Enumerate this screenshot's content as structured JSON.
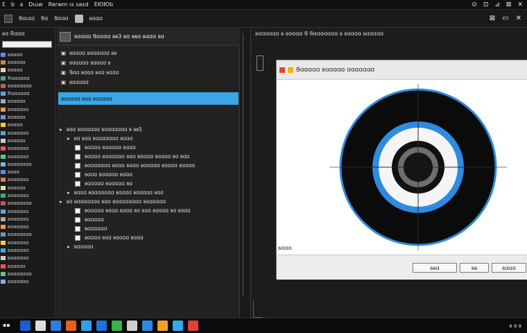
{
  "menubar": {
    "items": [
      "Ɛ",
      "b",
      "ꞩ",
      "Dɩuw",
      "Rerwm ɩs sasd",
      "ЕЮЮb"
    ],
    "right_icons": [
      "⊙",
      "⊡",
      "⊿",
      "⊠",
      "✕"
    ]
  },
  "toolbar": {
    "items": [
      "Ꞩɑɩɑɑ",
      "Ꞩɑ",
      "Ꞩɑɑɑ",
      "ꞩɑɑɑ"
    ],
    "right": [
      "⊠",
      "▭",
      "✕"
    ]
  },
  "sidebar": {
    "title": "ꞩɑ Rɑɑɑ",
    "items": [
      "ꞩɑɑɑɑ",
      "ꞩɑɑɑɑɑ",
      "ꞩɑɑɑɑ",
      "Rɑɑɑɑɑɑ",
      "ꞩɑɑɑɑɑɑɑ",
      "Rɑɑɑɑɑɑ",
      "ꞩɑɑɑɑɑ",
      "ꞩɑɑɑɑɑɑ",
      "ꞩɑɑɑɑɑ",
      "ꞩɑɑɑɑ",
      "ꞩɑɑɑɑɑɑ",
      "ꞩɑɑɑɑɑ",
      "ꞩɑɑɑɑɑɑ",
      "ꞩɑɑɑɑɑɑ",
      "ꞩɑɑɑɑɑɑɑ",
      "ꞩɑɑɑ",
      "ꞩɑɑɑɑɑɑ",
      "ꞩɑɑɑɑɑ",
      "ꞩɑɑɑɑɑɑ",
      "ꞩɑɑɑɑɑɑɑ",
      "ꞩɑɑɑɑɑɑ",
      "ꞩɑɑɑɑɑɑ",
      "ꞩɑɑɑɑɑɑ",
      "ꞩɑɑɑɑɑɑɑ",
      "ꞩɑɑɑɑɑɑ",
      "ꞩɑɑɑɑɑɑ",
      "ꞩɑɑɑɑɑɑ",
      "ꞩɑɑɑɑɑ",
      "ꞩɑɑɑɑɑɑɑ",
      "ꞩɑɑɑɑɑɑ"
    ]
  },
  "middle": {
    "header": "ꞩɑɑɑɑ Ꞩɑɑɑɑ ꞩꞩ3 ꞩɑ ꞩꞩɑ ꞩɑɑɑ ꞩɑ",
    "rows": [
      {
        "text": "ꞩɑɑɑɑ ꞩɑɑɑɑɑɑ ꞩꞩ",
        "indent": 0
      },
      {
        "text": "ꞩɑɑɑɑɑ ꞩɑɑɑɑ ꞩ",
        "indent": 0
      },
      {
        "text": "Ꞩɑɑ ꞩɑɑɑ ꞩɑɑ ꞩɑɑɑ",
        "indent": 0
      },
      {
        "text": "ꞩɑɑɑɑɑ",
        "indent": 0
      }
    ],
    "selected": "ꞩɑɑɑɑɑ ꞩɑɑ ꞩɑɑɑɑɑ",
    "tree": [
      {
        "text": "ꞩɑɑ ꞩɑɑɑɑɑɑ ꞩɑɑɑɑɑɑɑ ꞩ ꞩꞩ5",
        "indent": 0
      },
      {
        "text": "ꞩɑ ꞩɑɑ ꞩɑɑɑɑɑɑɑ ꞩɑɑɑ",
        "indent": 1
      },
      {
        "text": "ꞩɑɑɑɑ ꞩɑɑɑɑɑ ꞩɑɑɑ",
        "indent": 2,
        "check": true
      },
      {
        "text": "ꞩɑɑɑɑ ꞩɑɑɑɑɑɑ ꞩɑɑ ꞩɑɑɑɑ ꞩɑɑɑɑ ꞩɑ ꞩɑɑ",
        "indent": 2,
        "check": true
      },
      {
        "text": "ꞩɑɑɑɑɑɑɑ ꞩɑɑɑ ꞩɑɑɑ ꞩɑɑɑɑɑ ꞩɑɑɑɑ ꞩɑɑɑɑ",
        "indent": 2,
        "check": true
      },
      {
        "text": "ꞩɑɑɑ ꞩɑɑɑɑɑ ꞩɑɑɑ",
        "indent": 2,
        "check": true
      },
      {
        "text": "ꞩɑɑɑɑɑ ꞩɑɑɑɑɑ ꞩɑ",
        "indent": 2,
        "check": true
      },
      {
        "text": "ꞩɑɑɑ ꞩɑɑɑɑɑɑɑ ꞩɑɑɑɑ ꞩɑɑɑɑɑ ꞩɑɑ",
        "indent": 1
      },
      {
        "text": "ꞩɑ ꞩɑɑɑɑɑɑɑ ꞩɑɑ ꞩɑɑɑɑɑɑɑɑ ꞩɑɑɑɑɑɑ",
        "indent": 0
      },
      {
        "text": "ꞩɑɑɑɑɑ ꞩɑɑɑ ꞩɑɑɑ ꞩɑ ꞩɑɑ ꞩɑɑɑɑ ꞩɑ ꞩɑɑɑ",
        "indent": 2,
        "check": true
      },
      {
        "text": "ꞩɑɑɑɑɑ",
        "indent": 2,
        "check": true
      },
      {
        "text": "ꞩɑɑɑɑɑɑ",
        "indent": 2,
        "check": true
      },
      {
        "text": "ꞩɑɑɑɑ ꞩɑɑ ꞩɑɑɑɑ ꞩɑɑɑ",
        "indent": 2,
        "check": true
      },
      {
        "text": "ꞩɑɑɑɑɑ",
        "indent": 1
      }
    ]
  },
  "right_header": "ꞩɑɑɑɑɑɑ ꞩ ꞩɑɑɑɑ Ꞩ Ꞩɑɑɑɑɑɑɑ ꞩ ꞩɑɑɑɑ ꞩɑɑɑɑɑ",
  "dialog": {
    "title": "Ꞩɑɑɑɑɑ ꞩɑɑɑɑɑ ɑɑɑɑɑɑɑ",
    "status": "ꞩɑɑɑ",
    "buttons": [
      "ꞩꞩɑ",
      "ꞩꞩ",
      "ꞩɑɑɑ"
    ],
    "target_colors": {
      "outer": "#0b0b0b",
      "ring": "#2f8be0",
      "inner": "#111111",
      "hub": "#6e6e6e"
    }
  },
  "taskbar": {
    "icons": [
      "#1b5fd1",
      "#dddddd",
      "#2c7de0",
      "#e4601b",
      "#2ea0f0",
      "#1d73d6",
      "#3bb14a",
      "#cfcfcf",
      "#2a8ae0",
      "#f0a020",
      "#35a6f0",
      "#e0413a"
    ],
    "clock": "ꞩ ꞩ ꞩ"
  }
}
